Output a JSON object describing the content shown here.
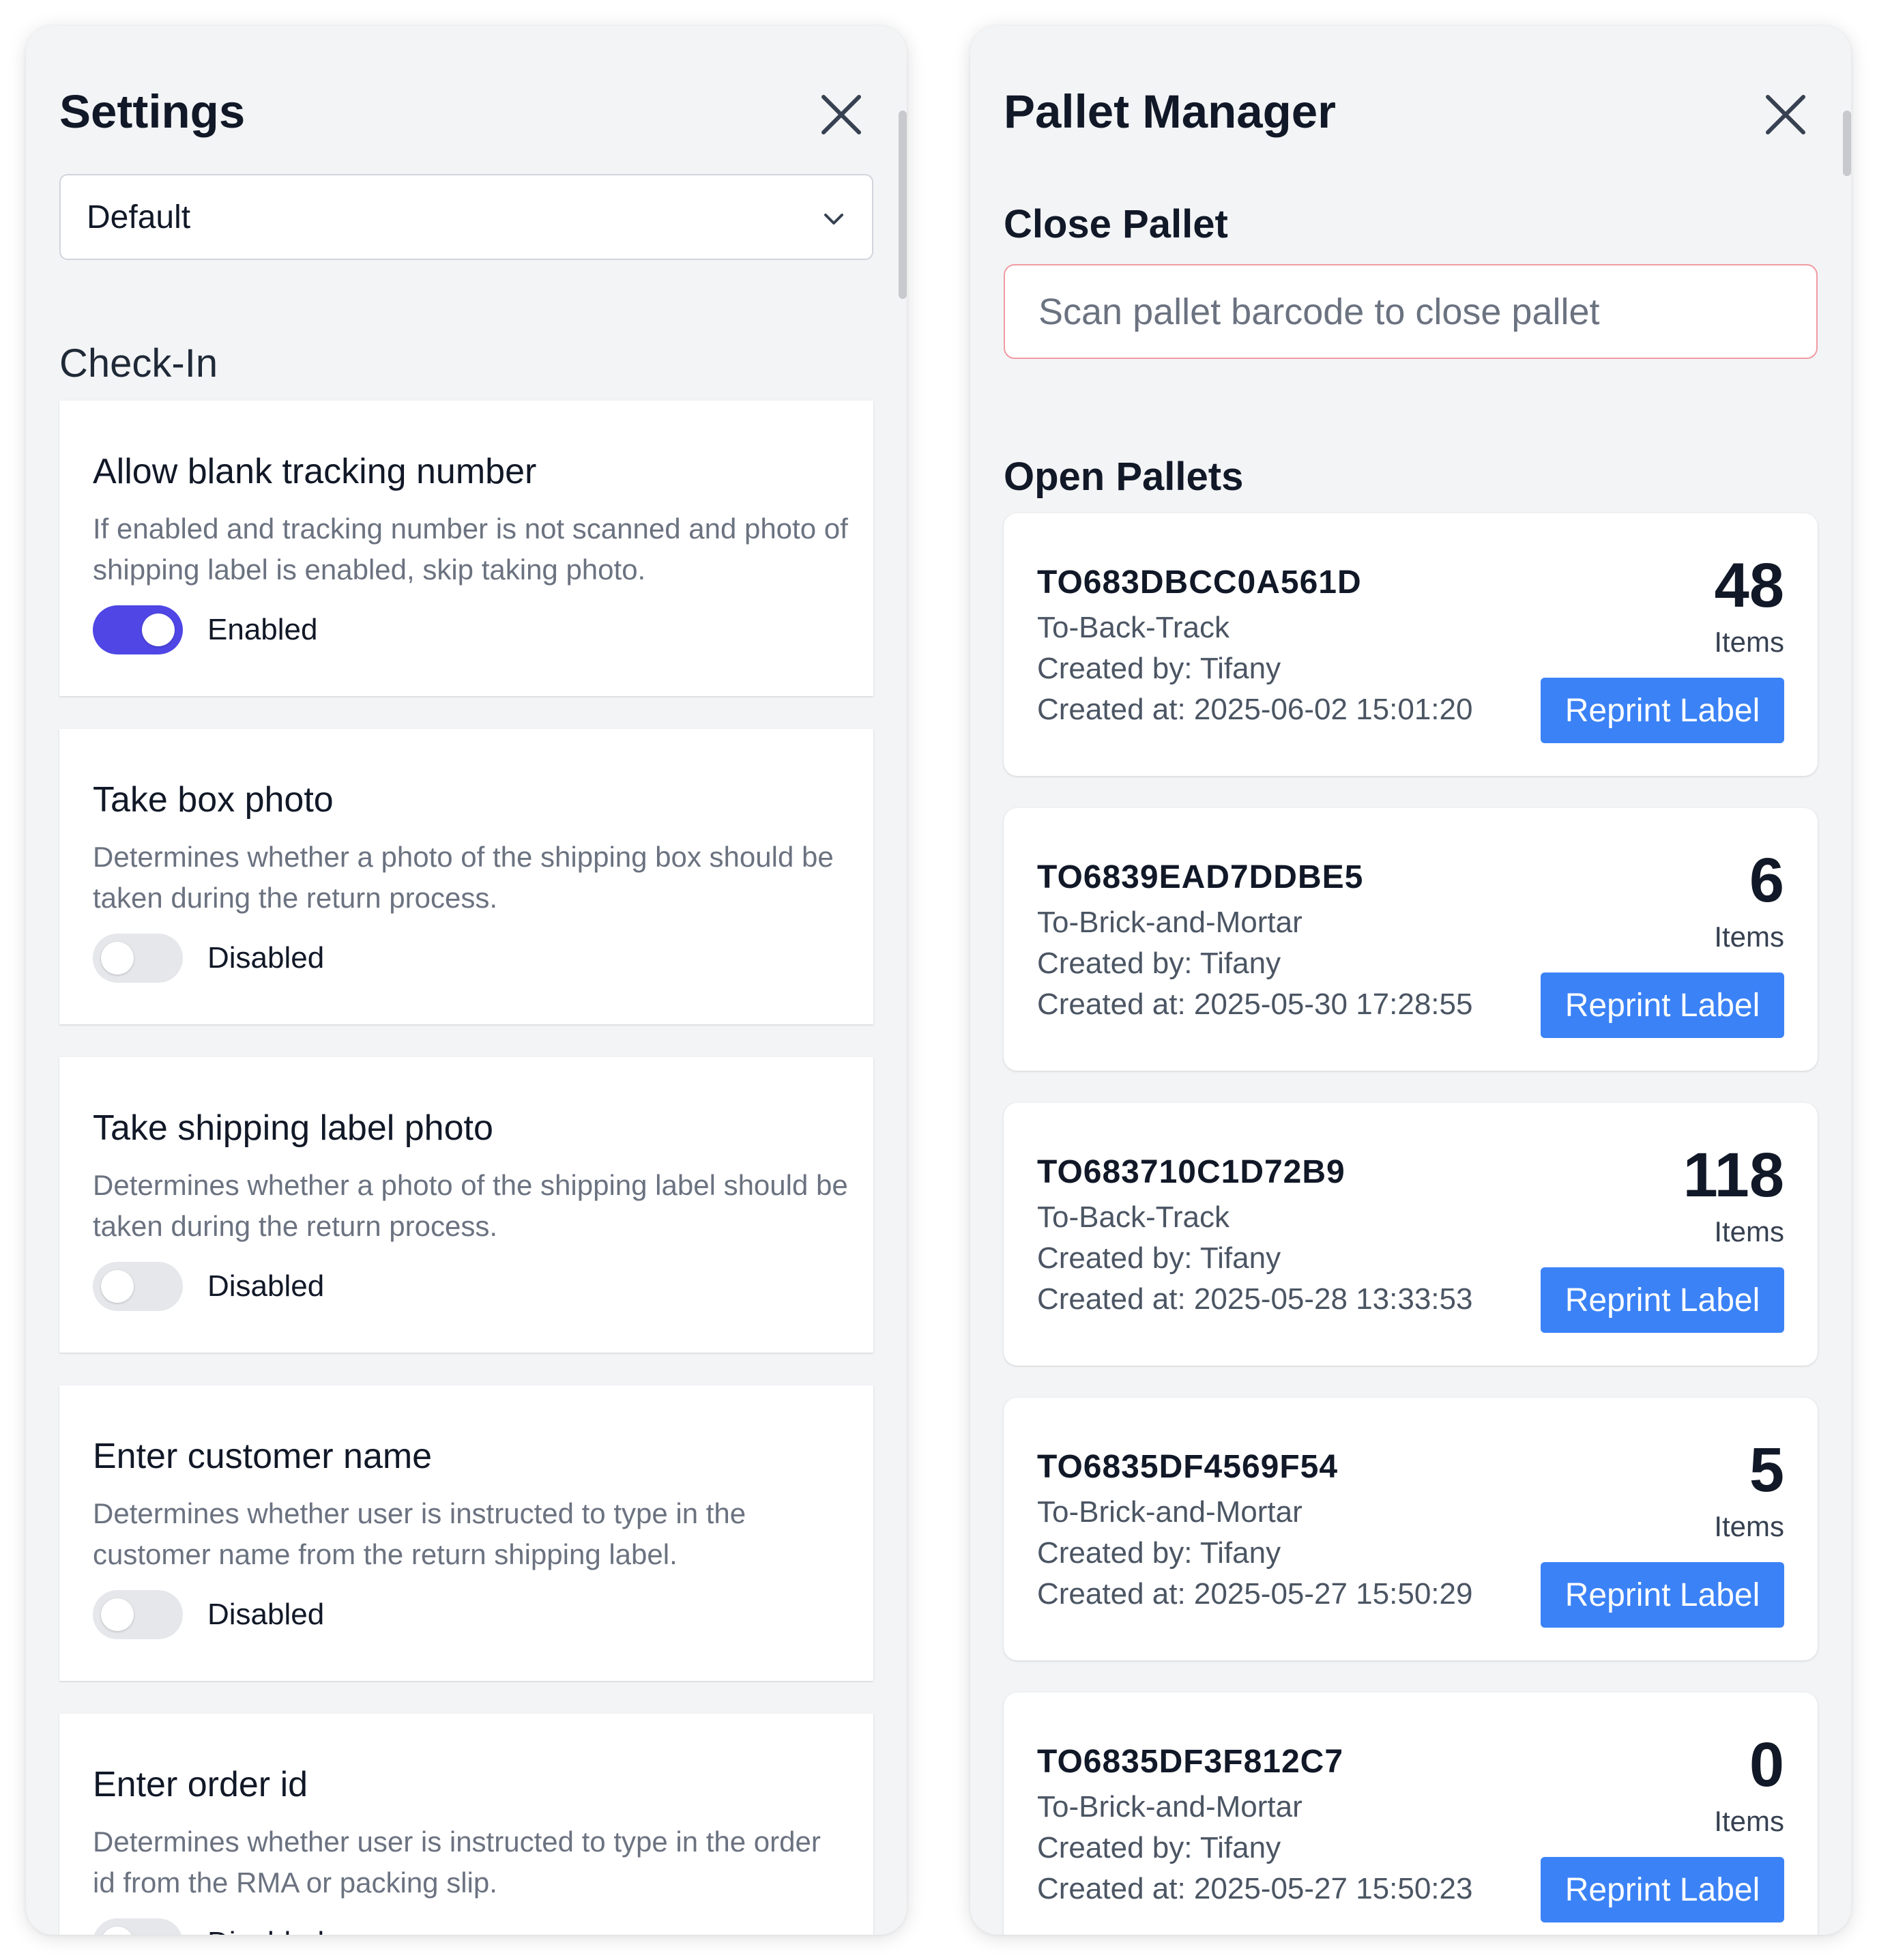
{
  "settings": {
    "title": "Settings",
    "profile_select": {
      "value": "Default"
    },
    "section_heading": "Check-In",
    "cards": [
      {
        "title": "Allow blank tracking number",
        "description": "If enabled and tracking number is not scanned and photo of shipping label is enabled, skip taking photo.",
        "enabled": true,
        "status": "Enabled"
      },
      {
        "title": "Take box photo",
        "description": "Determines whether a photo of the shipping box should be taken during the return process.",
        "enabled": false,
        "status": "Disabled"
      },
      {
        "title": "Take shipping label photo",
        "description": "Determines whether a photo of the shipping label should be taken during the return process.",
        "enabled": false,
        "status": "Disabled"
      },
      {
        "title": "Enter customer name",
        "description": "Determines whether user is instructed to type in the customer name from the return shipping label.",
        "enabled": false,
        "status": "Disabled"
      },
      {
        "title": "Enter order id",
        "description": "Determines whether user is instructed to type in the order id from the RMA or packing slip.",
        "enabled": false,
        "status": "Disabled"
      }
    ]
  },
  "pallet_manager": {
    "title": "Pallet Manager",
    "close_pallet": {
      "heading": "Close Pallet",
      "placeholder": "Scan pallet barcode to close pallet"
    },
    "open_pallets": {
      "heading": "Open Pallets",
      "items_label": "Items",
      "reprint_label": "Reprint Label",
      "pallets": [
        {
          "id": "TO683DBCC0A561D",
          "destination": "To-Back-Track",
          "created_by": "Created by: Tifany",
          "created_at": "Created at: 2025-06-02 15:01:20",
          "count": "48"
        },
        {
          "id": "TO6839EAD7DDBE5",
          "destination": "To-Brick-and-Mortar",
          "created_by": "Created by: Tifany",
          "created_at": "Created at: 2025-05-30 17:28:55",
          "count": "6"
        },
        {
          "id": "TO683710C1D72B9",
          "destination": "To-Back-Track",
          "created_by": "Created by: Tifany",
          "created_at": "Created at: 2025-05-28 13:33:53",
          "count": "118"
        },
        {
          "id": "TO6835DF4569F54",
          "destination": "To-Brick-and-Mortar",
          "created_by": "Created by: Tifany",
          "created_at": "Created at: 2025-05-27 15:50:29",
          "count": "5"
        },
        {
          "id": "TO6835DF3F812C7",
          "destination": "To-Brick-and-Mortar",
          "created_by": "Created by: Tifany",
          "created_at": "Created at: 2025-05-27 15:50:23",
          "count": "0"
        }
      ]
    }
  },
  "colors": {
    "toggle_on": "#4f46e5",
    "toggle_off": "#e5e7eb",
    "reprint_button": "#3b82f6",
    "scan_input_border": "#f19aa2",
    "panel_background": "#f3f4f6"
  },
  "icons": {
    "close": "close-icon",
    "dropdown": "chevron-down-icon"
  }
}
